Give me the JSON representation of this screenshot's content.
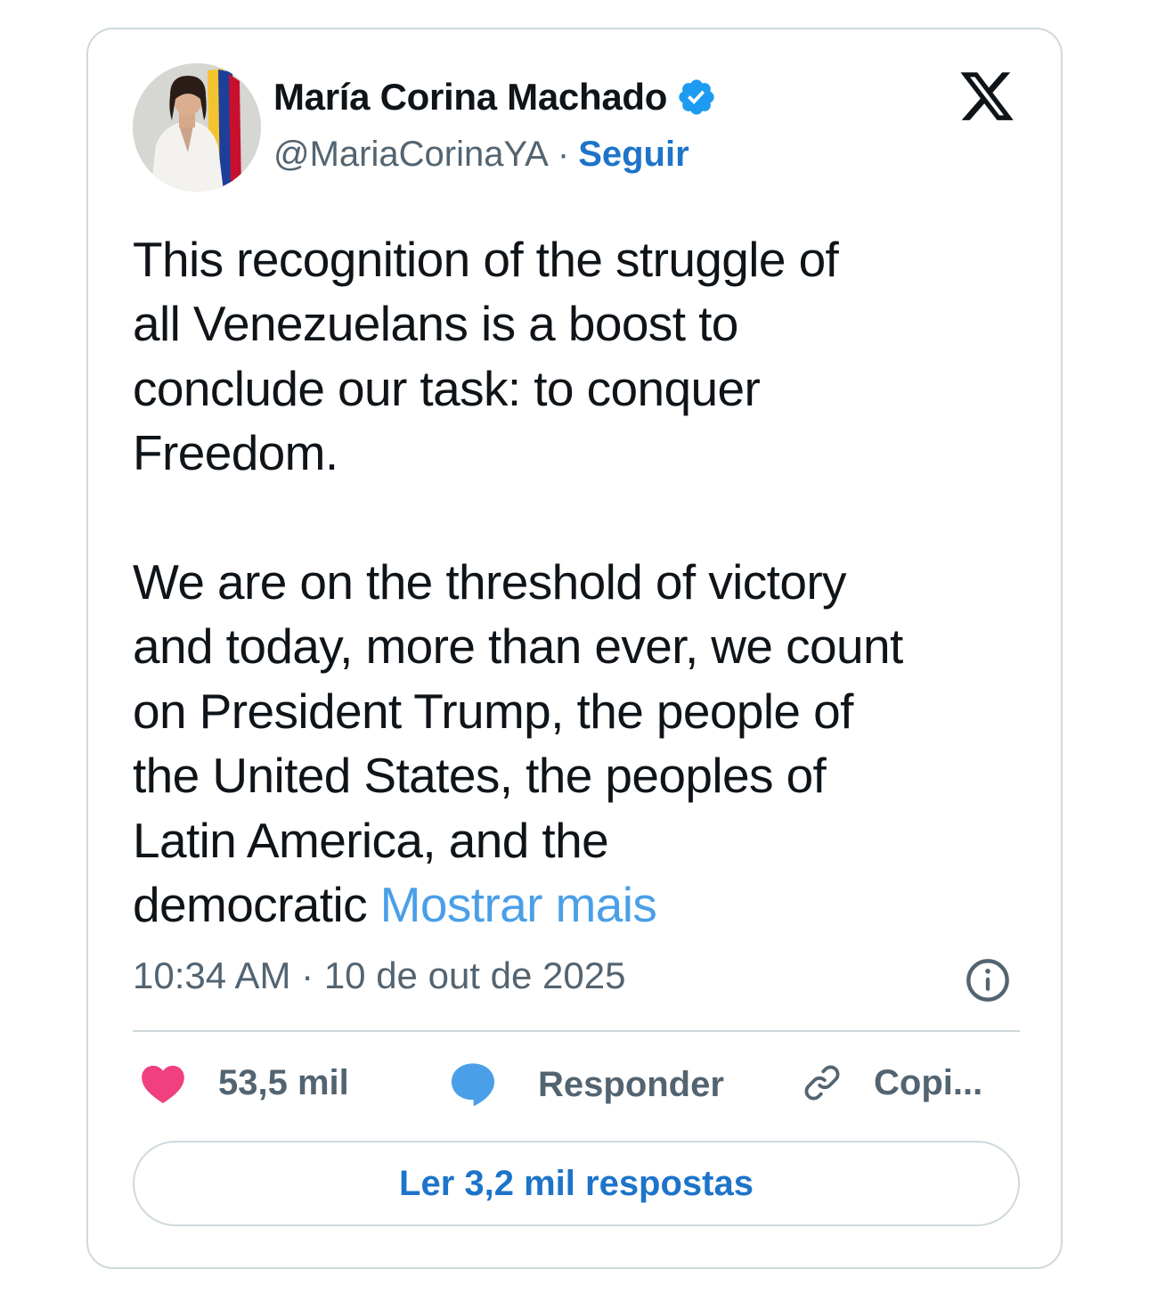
{
  "author": {
    "name": "María Corina Machado",
    "handle": "@MariaCorinaYA",
    "separator": "·",
    "follow_label": "Seguir",
    "verified_icon": "verified-badge-icon"
  },
  "brand_icon": "x-logo-icon",
  "tweet": {
    "text": "This recognition of the struggle of\nall Venezuelans is a boost to\nconclude our task: to conquer\nFreedom.\n\nWe are on the threshold of victory\nand today, more than ever, we count\non President Trump, the people of\nthe United States, the peoples of\nLatin America, and the\ndemocratic ",
    "show_more": "Mostrar mais",
    "time": "10:34 AM",
    "separator": "·",
    "date": "10 de out de 2025"
  },
  "actions": {
    "like_count": "53,5 mil",
    "reply_label": "Responder",
    "copy_label": "Copi..."
  },
  "read_replies_label": "Ler 3,2 mil respostas",
  "colors": {
    "accent": "#1d74c9",
    "link": "#4a9fe8",
    "heart": "#f0407f",
    "reply_bubble": "#4a9fe8",
    "verified": "#1d9bf0",
    "muted": "#536471",
    "border": "#cfd9de"
  }
}
